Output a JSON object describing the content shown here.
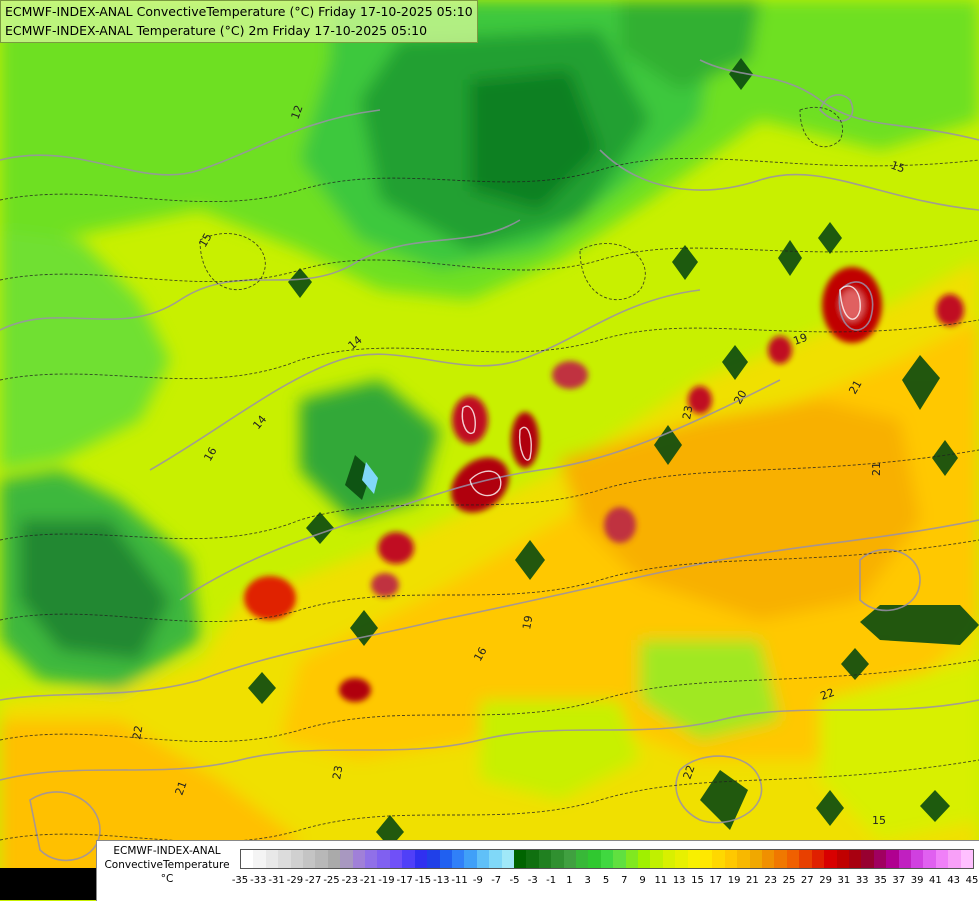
{
  "title_lines": [
    "ECMWF-INDEX-ANAL ConvectiveTemperature (°C) Friday 17-10-2025 05:10",
    "ECMWF-INDEX-ANAL Temperature (°C) 2m Friday 17-10-2025 05:10"
  ],
  "legend": {
    "line1": "ECMWF-INDEX-ANAL",
    "line2": "ConvectiveTemperature",
    "line3": "°C",
    "ticks": [
      "-35",
      "-33",
      "-31",
      "-29",
      "-27",
      "-25",
      "-23",
      "-21",
      "-19",
      "-17",
      "-15",
      "-13",
      "-11",
      "-9",
      "-7",
      "-5",
      "-3",
      "-1",
      "1",
      "3",
      "5",
      "7",
      "9",
      "11",
      "13",
      "15",
      "17",
      "19",
      "21",
      "23",
      "25",
      "27",
      "29",
      "31",
      "33",
      "35",
      "37",
      "39",
      "41",
      "43",
      "45"
    ],
    "colors": [
      "#ffffff",
      "#f4f4f4",
      "#e8e8e8",
      "#dcdcdc",
      "#d0d0d0",
      "#c4c4c4",
      "#b8b8b8",
      "#aaaaaa",
      "#a898c0",
      "#a080d8",
      "#9070e8",
      "#8060f0",
      "#7050f8",
      "#5040f8",
      "#3030f0",
      "#2040e8",
      "#2060f0",
      "#3080f8",
      "#40a0f8",
      "#60c0f8",
      "#80d8f8",
      "#a0e8f8",
      "#006400",
      "#107010",
      "#208020",
      "#309030",
      "#40a040",
      "#38b838",
      "#30c830",
      "#40d840",
      "#60e040",
      "#80e820",
      "#a0f000",
      "#c0f000",
      "#d8f000",
      "#e8f000",
      "#f8f000",
      "#ffe800",
      "#ffd800",
      "#ffc800",
      "#f8b800",
      "#f0a800",
      "#f09000",
      "#f07800",
      "#f06000",
      "#e84000",
      "#e02000",
      "#d80000",
      "#c00000",
      "#a80010",
      "#980030",
      "#a00060",
      "#b00090",
      "#c020c0",
      "#d040e0",
      "#e060f0",
      "#f080f8",
      "#f8a0f8",
      "#ffc0ff"
    ]
  },
  "contour_labels": [
    "12",
    "15",
    "15",
    "14",
    "14",
    "16",
    "16",
    "19",
    "21",
    "21",
    "22",
    "22",
    "23",
    "23",
    "22",
    "21",
    "20",
    "15",
    "19"
  ]
}
